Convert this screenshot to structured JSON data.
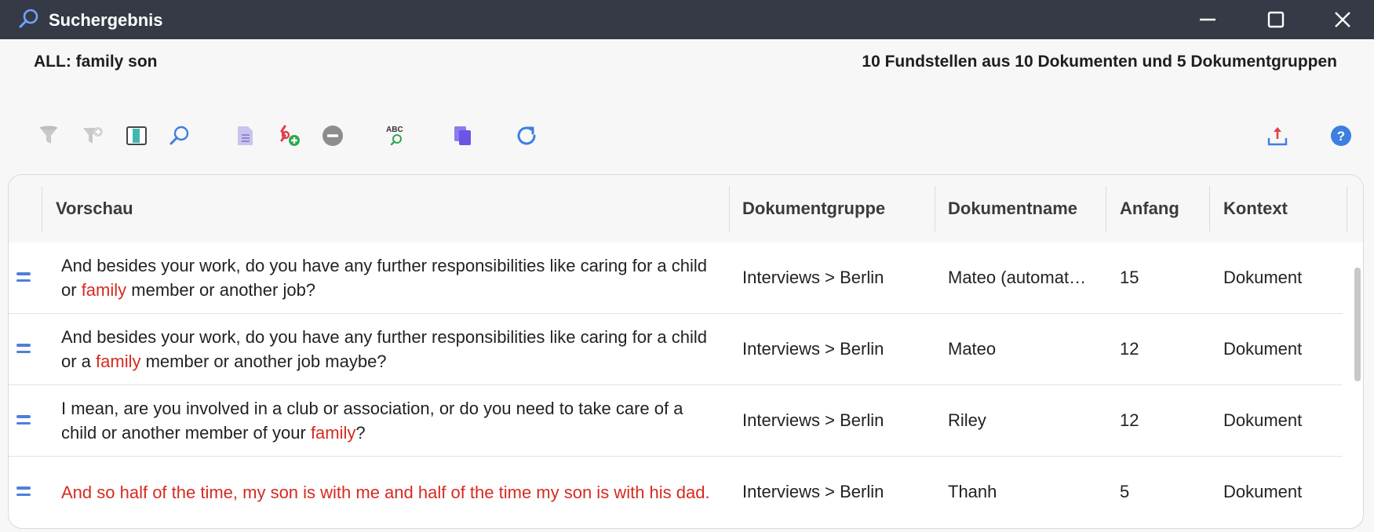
{
  "window": {
    "title": "Suchergebnis",
    "icon": "search-icon",
    "controls": [
      "minimize-icon",
      "maximize-icon",
      "close-icon"
    ]
  },
  "header": {
    "query": "ALL: family son",
    "summary": "10 Fundstellen aus 10 Dokumenten und 5 Dokumentgruppen"
  },
  "toolbar": {
    "tools": [
      {
        "name": "filter-icon",
        "enabled": false
      },
      {
        "name": "clear-filter-icon",
        "enabled": false
      },
      {
        "name": "toggle-preview-icon",
        "enabled": true
      },
      {
        "name": "search-icon",
        "enabled": true
      },
      {
        "name": "document-list-icon",
        "enabled": false
      },
      {
        "name": "code-add-icon",
        "enabled": true
      },
      {
        "name": "remove-icon",
        "enabled": true
      },
      {
        "name": "spell-search-icon",
        "enabled": true
      },
      {
        "name": "copy-icon",
        "enabled": true
      },
      {
        "name": "refresh-icon",
        "enabled": true
      },
      {
        "name": "export-icon",
        "enabled": true
      },
      {
        "name": "help-icon",
        "enabled": true
      }
    ]
  },
  "table": {
    "columns": [
      "Vorschau",
      "Dokumentgruppe",
      "Dokumentname",
      "Anfang",
      "Kontext"
    ],
    "highlight_color": "#d62a20",
    "rows": [
      {
        "preview": [
          "And besides your work, do you have any further responsibilities like caring for a child or ",
          "family",
          " member or another job?"
        ],
        "group": "Interviews > Berlin",
        "name": "Mateo (automat…",
        "start": "15",
        "context": "Dokument"
      },
      {
        "preview": [
          "And besides your work, do you have any further responsibilities like caring for a child or a ",
          "family",
          " member or another job maybe?"
        ],
        "group": "Interviews > Berlin",
        "name": "Mateo",
        "start": "12",
        "context": "Dokument"
      },
      {
        "preview": [
          "I mean, are you involved in a club or association, or do you need to take care of a child or another member of your ",
          "family",
          "?"
        ],
        "group": "Interviews > Berlin",
        "name": "Riley",
        "start": "12",
        "context": "Dokument"
      },
      {
        "preview": [
          "",
          "And so half of the time, my son is with me and half of the time my son is with his dad.",
          ""
        ],
        "group": "Interviews > Berlin",
        "name": "Thanh",
        "start": "5",
        "context": "Dokument"
      }
    ]
  }
}
